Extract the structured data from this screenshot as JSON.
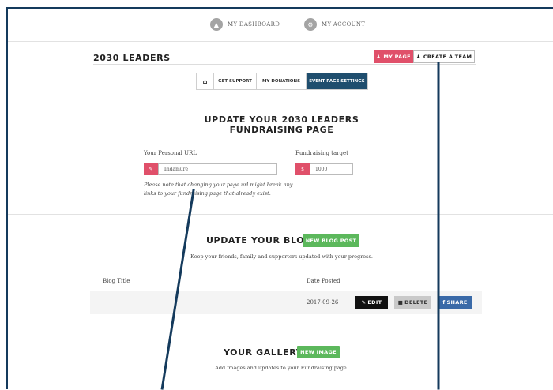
{
  "topnav": {
    "dashboard_label": "MY DASHBOARD",
    "account_label": "MY ACCOUNT"
  },
  "page": {
    "title": "2030 LEADERS",
    "my_page_label": "MY PAGE",
    "create_team_label": "CREATE A TEAM"
  },
  "tabs": {
    "home_icon": "⌂",
    "items": [
      "GET SUPPORT",
      "MY DONATIONS",
      "EVENT PAGE SETTINGS"
    ]
  },
  "settings": {
    "heading_line1": "UPDATE YOUR 2030 LEADERS",
    "heading_line2": "FUNDRAISING PAGE",
    "url_label": "Your Personal URL",
    "url_value": "lindamure",
    "target_label": "Fundraising target",
    "target_value": "1000",
    "target_prefix": "$",
    "warning_line1": "Please note that changing your page url might break any",
    "warning_line2": "links to your fundraising page that already exist."
  },
  "blog": {
    "heading": "UPDATE YOUR BLOG",
    "new_post_label": "NEW BLOG POST",
    "subtitle": "Keep your friends, family and supporters updated with your progress.",
    "columns": [
      "Blog Title",
      "Date Posted"
    ],
    "rows": [
      {
        "title": "",
        "date": "2017-09-26"
      }
    ],
    "edit_label": "EDIT",
    "delete_label": "DELETE",
    "share_label": "SHARE"
  },
  "gallery": {
    "heading": "YOUR GALLERY",
    "new_image_label": "NEW IMAGE",
    "subtitle": "Add images and updates to your Fundraising page."
  },
  "colors": {
    "accent_pink": "#e0506a",
    "tab_active": "#1f4e6e",
    "green": "#5cb85c",
    "share_blue": "#3a6aa8",
    "frame_navy": "#143a5c"
  }
}
